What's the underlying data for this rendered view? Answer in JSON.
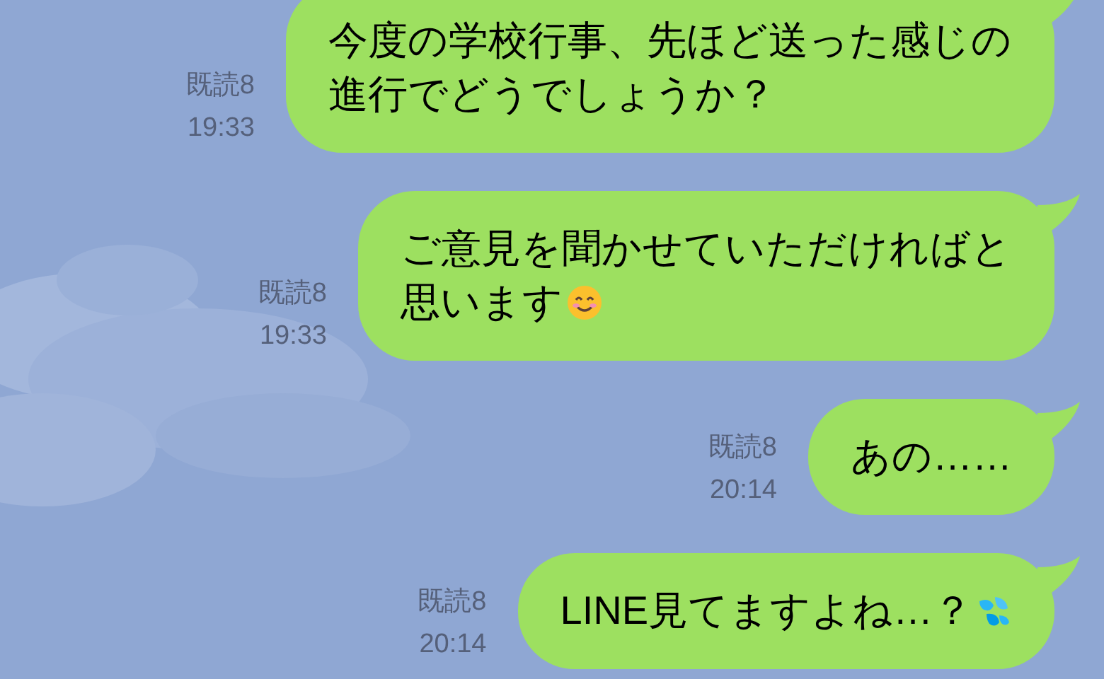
{
  "messages": [
    {
      "kind": "text",
      "lines": [
        "今度の学校行事、先ほど送った感じの",
        "進行でどうでしょうか？"
      ],
      "read": "既読8",
      "time": "19:33"
    },
    {
      "kind": "smiling",
      "lines": [
        "ご意見を聞かせていただければと",
        "思います"
      ],
      "read": "既読8",
      "time": "19:33"
    },
    {
      "kind": "text",
      "lines": [
        "あの……"
      ],
      "read": "既読8",
      "time": "20:14"
    },
    {
      "kind": "sweat",
      "lines": [
        "LINE見てますよね…？"
      ],
      "read": "既読8",
      "time": "20:14"
    }
  ]
}
